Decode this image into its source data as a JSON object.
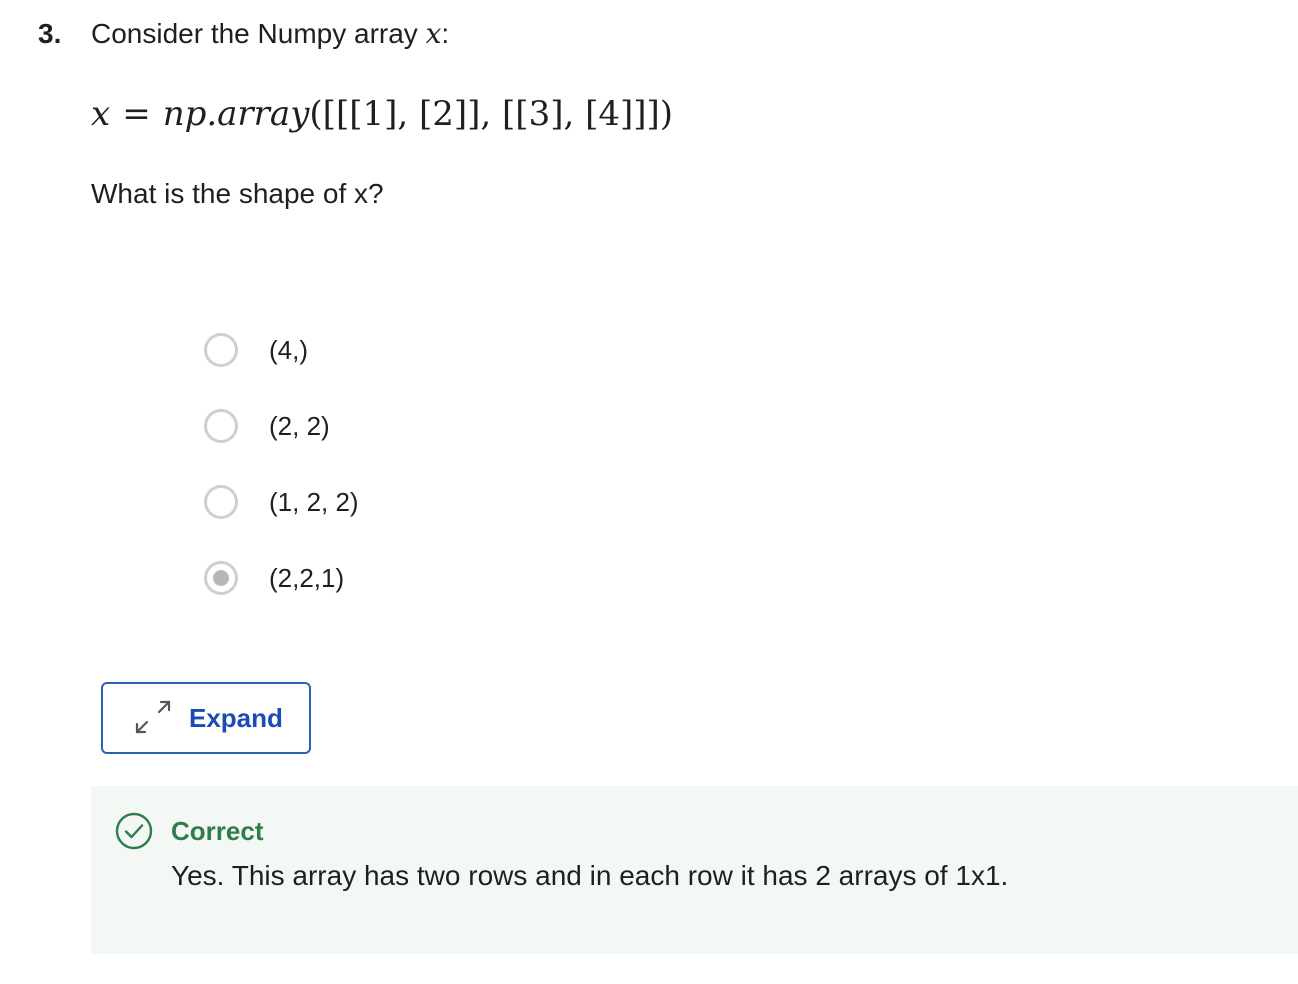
{
  "question": {
    "number": "3.",
    "prompt_text": "Consider the Numpy array ",
    "prompt_var": "x",
    "prompt_suffix": ":",
    "math": {
      "lhs": "x",
      "eq": "=",
      "fn": "np.array",
      "args": "([[[1], [2]], [[3], [4]]])"
    },
    "text": "What is the shape of x?"
  },
  "options": [
    {
      "label": "(4,)",
      "selected": false
    },
    {
      "label": "(2, 2)",
      "selected": false
    },
    {
      "label": "(1, 2, 2)",
      "selected": false
    },
    {
      "label": "(2,2,1)",
      "selected": true
    }
  ],
  "expand_button": {
    "label": "Expand",
    "icon": "expand-arrows-icon",
    "color": "#1c4bb5"
  },
  "feedback": {
    "status": "Correct",
    "icon": "check-circle-icon",
    "color": "#2e7d4a",
    "text": "Yes. This array has two rows and in each row it has 2 arrays of 1x1."
  }
}
